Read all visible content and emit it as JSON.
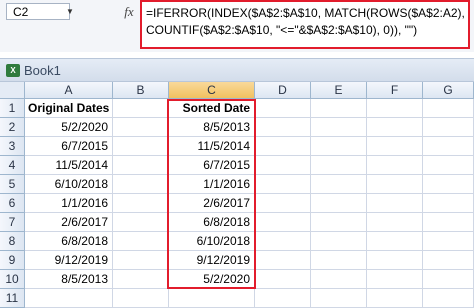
{
  "formula_bar": {
    "name_box": "C2",
    "fx_label": "fx",
    "formula_lines": [
      "=IFERROR(INDEX($A$2:$A$10, MATCH(ROWS($A$2:A2),",
      "COUNTIF($A$2:$A$10, \"<=\"&$A$2:$A$10), 0)), \"\")"
    ]
  },
  "window": {
    "title": "Book1",
    "icon": "excel-workbook-icon"
  },
  "columns": [
    "A",
    "B",
    "C",
    "D",
    "E",
    "F",
    "G"
  ],
  "selected_column": "C",
  "rows": [
    "1",
    "2",
    "3",
    "4",
    "5",
    "6",
    "7",
    "8",
    "9",
    "10",
    "11"
  ],
  "headers": {
    "a": "Original Dates",
    "c": "Sorted Date"
  },
  "original_dates": [
    "5/2/2020",
    "6/7/2015",
    "11/5/2014",
    "6/10/2018",
    "1/1/2016",
    "2/6/2017",
    "6/8/2018",
    "9/12/2019",
    "8/5/2013"
  ],
  "sorted_dates": [
    "8/5/2013",
    "11/5/2014",
    "6/7/2015",
    "1/1/2016",
    "2/6/2017",
    "6/8/2018",
    "6/10/2018",
    "9/12/2019",
    "5/2/2020"
  ],
  "colors": {
    "highlight": "#e21c2c",
    "selected_header": "#f1c15f"
  }
}
